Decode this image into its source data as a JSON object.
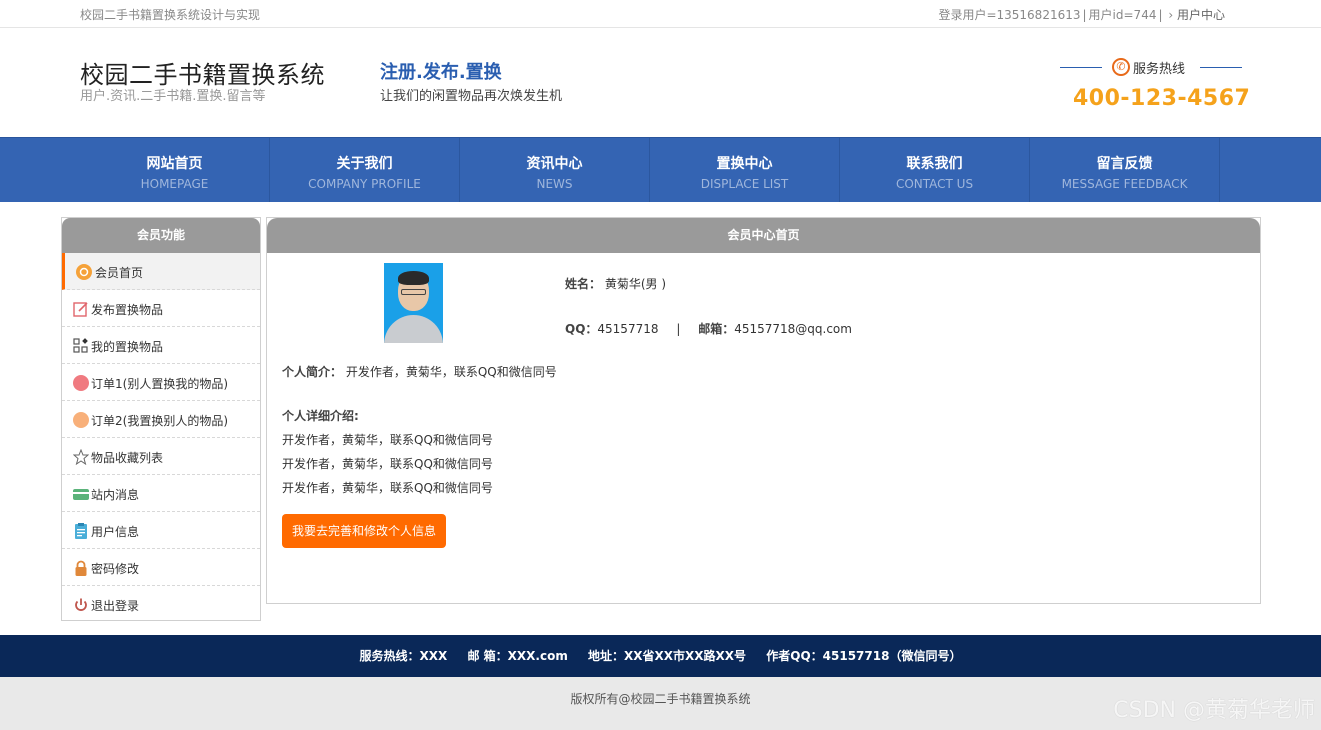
{
  "topbar": {
    "site_title": "校园二手书籍置换系统设计与实现",
    "login_user": "登录用户=13516821613",
    "user_id": "用户id=744",
    "sep": "|",
    "user_center_arrow": "›",
    "user_center": "用户中心"
  },
  "header": {
    "brand_title": "校园二手书籍置换系统",
    "brand_sub": "用户.资讯.二手书籍.置换.留言等",
    "slogan_title": "注册.发布.置换",
    "slogan_sub": "让我们的闲置物品再次焕发生机",
    "hotline_label": "服务热线",
    "hotline_number": "400-123-4567"
  },
  "nav": [
    {
      "cn": "网站首页",
      "en": "HOMEPAGE"
    },
    {
      "cn": "关于我们",
      "en": "COMPANY PROFILE"
    },
    {
      "cn": "资讯中心",
      "en": "NEWS"
    },
    {
      "cn": "置换中心",
      "en": "DISPLACE LIST"
    },
    {
      "cn": "联系我们",
      "en": "CONTACT US"
    },
    {
      "cn": "留言反馈",
      "en": "MESSAGE FEEDBACK"
    }
  ],
  "sidebar": {
    "title": "会员功能",
    "items": [
      {
        "label": "会员首页",
        "icon": "home-icon"
      },
      {
        "label": "发布置换物品",
        "icon": "edit-icon"
      },
      {
        "label": "我的置换物品",
        "icon": "grid-icon"
      },
      {
        "label": "订单1(别人置换我的物品)",
        "icon": "order-icon"
      },
      {
        "label": "订单2(我置换别人的物品)",
        "icon": "order2-icon"
      },
      {
        "label": "物品收藏列表",
        "icon": "star-icon"
      },
      {
        "label": "站内消息",
        "icon": "message-icon"
      },
      {
        "label": "用户信息",
        "icon": "user-info-icon"
      },
      {
        "label": "密码修改",
        "icon": "lock-icon"
      },
      {
        "label": "退出登录",
        "icon": "power-icon"
      }
    ]
  },
  "main": {
    "title": "会员中心首页",
    "name_label": "姓名：",
    "name_value": "黄菊华(男 )",
    "qq_label": "QQ：",
    "qq_value": "45157718",
    "contact_sep": "|",
    "email_label": "邮箱：",
    "email_value": "45157718@qq.com",
    "intro_label": "个人简介：",
    "intro_value": "开发作者，黄菊华，联系QQ和微信同号",
    "detail_title": "个人详细介绍:",
    "detail_lines": [
      "开发作者，黄菊华，联系QQ和微信同号",
      "开发作者，黄菊华，联系QQ和微信同号",
      "开发作者，黄菊华，联系QQ和微信同号"
    ],
    "edit_button": "我要去完善和修改个人信息"
  },
  "footer": {
    "hotline": "服务热线：XXX",
    "email": "邮 箱：XXX.com",
    "address": "地址：XX省XX市XX路XX号",
    "author_qq": "作者QQ：45157718（微信同号）",
    "copyright": "版权所有@校园二手书籍置换系统"
  },
  "watermark": "CSDN @黄菊华老师",
  "colors": {
    "nav": "#3464b3",
    "accent": "#ff6a00",
    "hotline": "#f5a21b",
    "footer": "#0a2858"
  }
}
